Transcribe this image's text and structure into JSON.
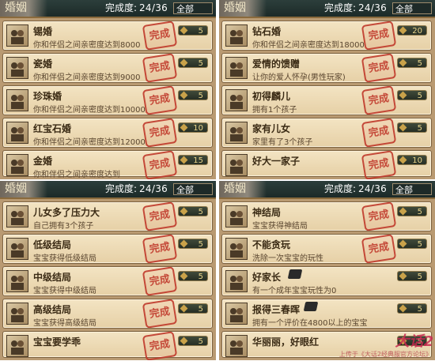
{
  "panels": [
    {
      "title": "婚姻",
      "progress_label": "完成度:",
      "progress_value": "24/36",
      "filter": "全部",
      "rows": [
        {
          "title": "锡婚",
          "desc": "你和伴侣之间亲密度达到8000",
          "stamp": "完成",
          "badge": "5"
        },
        {
          "title": "瓷婚",
          "desc": "你和伴侣之间亲密度达到9000",
          "stamp": "完成",
          "badge": "5"
        },
        {
          "title": "珍珠婚",
          "desc": "你和伴侣之间亲密度达到10000",
          "stamp": "完成",
          "badge": "5"
        },
        {
          "title": "红宝石婚",
          "desc": "你和伴侣之间亲密度达到12000",
          "stamp": "完成",
          "badge": "10"
        },
        {
          "title": "金婚",
          "desc": "你和伴侣之间亲密度达到",
          "stamp": "完成",
          "badge": "15"
        }
      ]
    },
    {
      "title": "婚姻",
      "progress_label": "完成度:",
      "progress_value": "24/36",
      "filter": "全部",
      "rows": [
        {
          "title": "钻石婚",
          "desc": "你和伴侣之间亲密度达到18000",
          "stamp": "完成",
          "badge": "20"
        },
        {
          "title": "爱情的馈赠",
          "desc": "让你的爱人怀孕(男性玩家)",
          "stamp": "完成",
          "badge": "5"
        },
        {
          "title": "初得麟儿",
          "desc": "拥有1个孩子",
          "stamp": "完成",
          "badge": "5"
        },
        {
          "title": "家有儿女",
          "desc": "家里有了3个孩子",
          "stamp": "完成",
          "badge": "5"
        },
        {
          "title": "好大一家子",
          "desc": "",
          "stamp": "完成",
          "badge": "10"
        }
      ]
    },
    {
      "title": "婚姻",
      "progress_label": "完成度:",
      "progress_value": "24/36",
      "filter": "全部",
      "rows": [
        {
          "title": "儿女多了压力大",
          "desc": "自己拥有3个孩子",
          "stamp": "完成",
          "badge": "5"
        },
        {
          "title": "低级结局",
          "desc": "宝宝获得低级结局",
          "stamp": "完成",
          "badge": "5"
        },
        {
          "title": "中级结局",
          "desc": "宝宝获得中级结局",
          "stamp": "完成",
          "badge": "5"
        },
        {
          "title": "高级结局",
          "desc": "宝宝获得高级结局",
          "stamp": "完成",
          "badge": "5"
        },
        {
          "title": "宝宝要学乖",
          "desc": "",
          "stamp": "完成",
          "badge": "5"
        }
      ]
    },
    {
      "title": "婚姻",
      "progress_label": "完成度:",
      "progress_value": "24/36",
      "filter": "全部",
      "rows": [
        {
          "title": "神结局",
          "desc": "宝宝获得神结局",
          "stamp": "完成",
          "badge": "5"
        },
        {
          "title": "不能贪玩",
          "desc": "洗除一次宝宝的玩性",
          "stamp": "完成",
          "badge": "5"
        },
        {
          "title": "好家长",
          "desc": "有一个成年宝宝玩性为0",
          "stamp": "",
          "badge": "5"
        },
        {
          "title": "报得三春晖",
          "desc": "拥有一个评价在4800以上的宝宝",
          "stamp": "",
          "badge": "5"
        },
        {
          "title": "华丽丽，好眼红",
          "desc": "",
          "stamp": "",
          "badge": "5"
        }
      ]
    }
  ],
  "watermark": "大话2",
  "watermark_sub": "上传于《大话2经典服官方论坛》"
}
